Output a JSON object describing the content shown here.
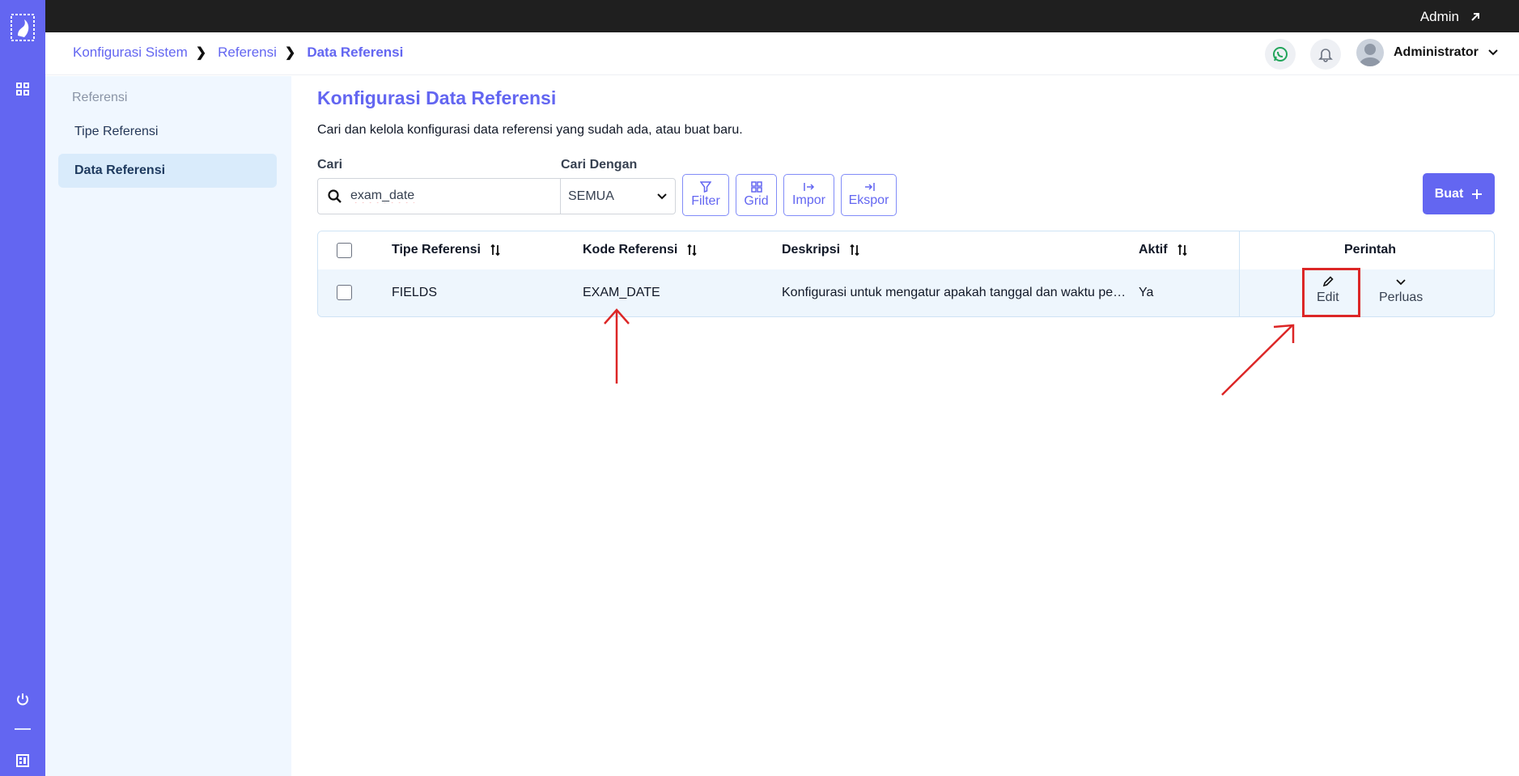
{
  "topbar": {
    "admin_label": "Admin"
  },
  "breadcrumb": {
    "items": [
      "Konfigurasi Sistem",
      "Referensi",
      "Data Referensi"
    ]
  },
  "header": {
    "user_name": "Administrator"
  },
  "sidebar": {
    "section": "Referensi",
    "items": [
      {
        "label": "Tipe Referensi"
      },
      {
        "label": "Data Referensi"
      }
    ]
  },
  "main": {
    "title": "Konfigurasi Data Referensi",
    "subtitle": "Cari dan kelola konfigurasi data referensi yang sudah ada, atau buat baru.",
    "search_label": "Cari",
    "search_value": "exam_date",
    "search_by_label": "Cari Dengan",
    "search_by_value": "SEMUA",
    "buttons": {
      "filter": "Filter",
      "grid": "Grid",
      "import": "Impor",
      "export": "Ekspor",
      "create": "Buat"
    }
  },
  "table": {
    "columns": [
      "Tipe Referensi",
      "Kode Referensi",
      "Deskripsi",
      "Aktif",
      "Perintah"
    ],
    "rows": [
      {
        "tipe": "FIELDS",
        "kode": "EXAM_DATE",
        "deskripsi": "Konfigurasi untuk mengatur apakah tanggal dan waktu pe…",
        "aktif": "Ya"
      }
    ],
    "actions": {
      "edit": "Edit",
      "expand": "Perluas"
    }
  },
  "colors": {
    "accent": "#6366f1",
    "annotation": "#dc2626"
  }
}
